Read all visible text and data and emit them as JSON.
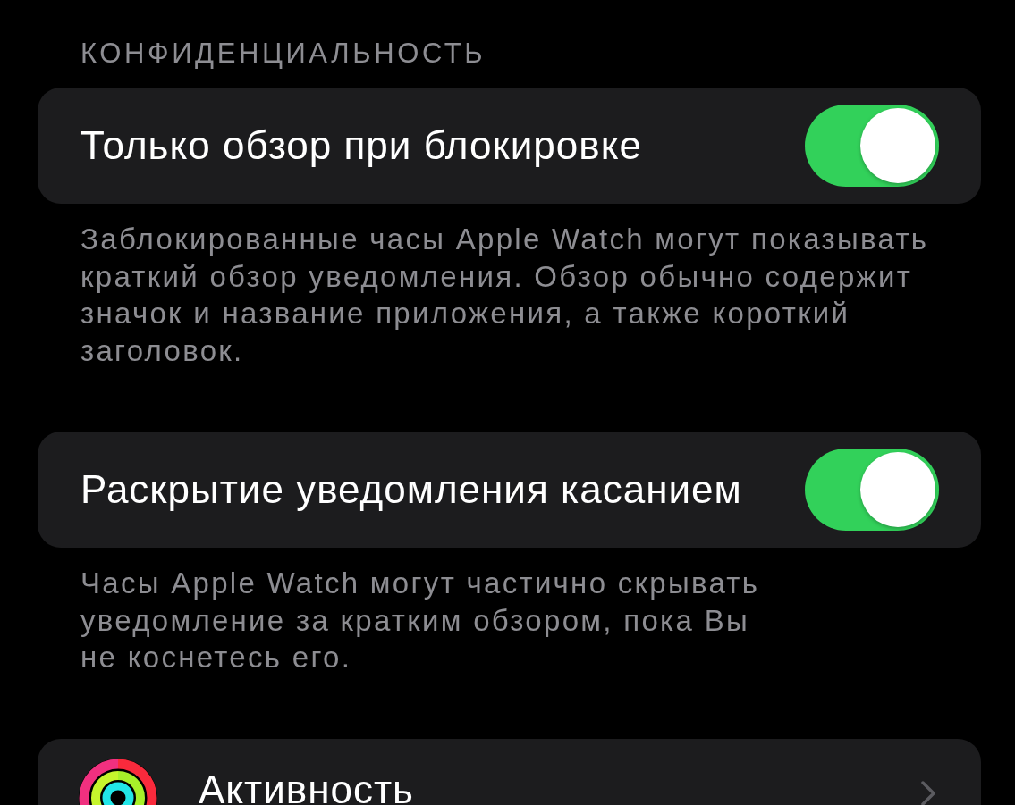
{
  "section_header": "КОНФИДЕНЦИАЛЬНОСТЬ",
  "settings": [
    {
      "kind": "toggle",
      "label": "Только обзор при блокировке",
      "on": true,
      "description": "Заблокированные часы Apple Watch могут показывать краткий обзор уведомления. Обзор обычно содержит значок и название приложения, а также короткий заголовок."
    },
    {
      "kind": "toggle",
      "label": "Раскрытие уведомления касанием",
      "on": true,
      "description": "Часы Apple Watch могут частично скрывать уведомление за кратким обзором, пока Вы не коснетесь его."
    },
    {
      "kind": "link",
      "label": "Активность"
    }
  ]
}
